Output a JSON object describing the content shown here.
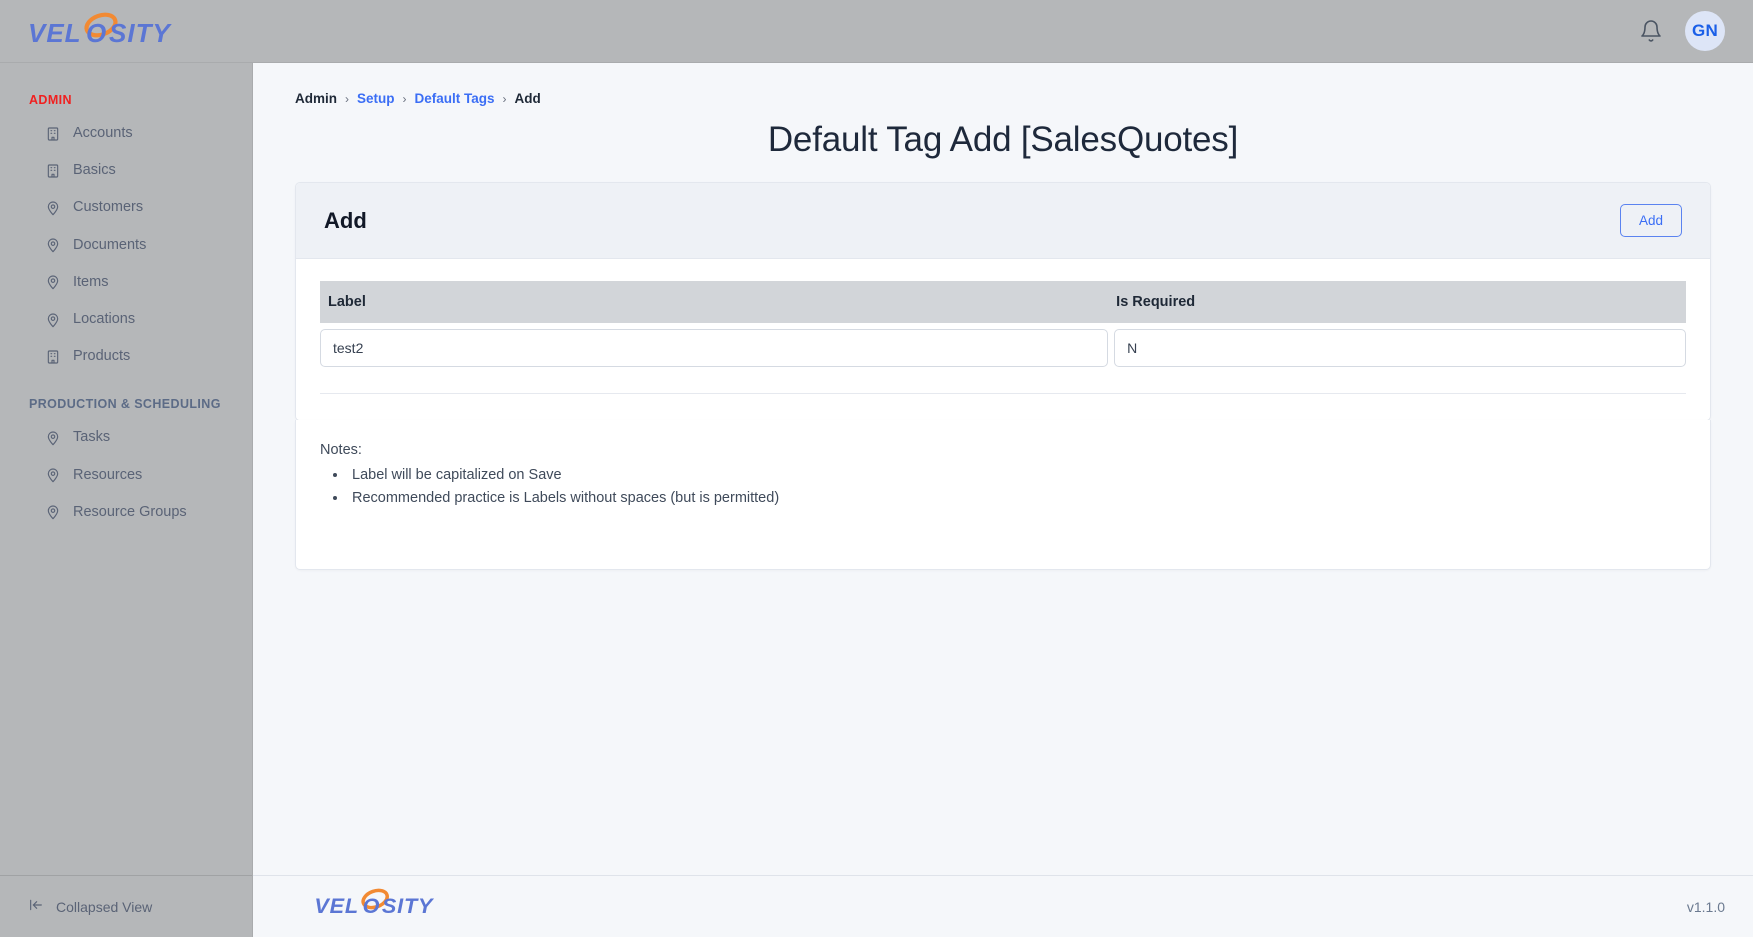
{
  "brand": {
    "name": "VELOSITY",
    "part1": "VEL",
    "part2": "SITY",
    "blue": "#5b76d4",
    "orange": "#f28a33"
  },
  "topbar": {
    "notifications_icon": "bell-icon",
    "avatar_initials": "GN"
  },
  "sidebar": {
    "sections": [
      {
        "title": "ADMIN",
        "color": "#f02020",
        "items": [
          {
            "label": "Accounts",
            "icon": "building-icon"
          },
          {
            "label": "Basics",
            "icon": "building-icon"
          },
          {
            "label": "Customers",
            "icon": "map-pin-icon"
          },
          {
            "label": "Documents",
            "icon": "map-pin-icon"
          },
          {
            "label": "Items",
            "icon": "map-pin-icon"
          },
          {
            "label": "Locations",
            "icon": "map-pin-icon"
          },
          {
            "label": "Products",
            "icon": "building-icon"
          }
        ]
      },
      {
        "title": "PRODUCTION & SCHEDULING",
        "color": "#5c6b86",
        "items": [
          {
            "label": "Tasks",
            "icon": "map-pin-icon"
          },
          {
            "label": "Resources",
            "icon": "map-pin-icon"
          },
          {
            "label": "Resource Groups",
            "icon": "map-pin-icon"
          }
        ]
      }
    ],
    "collapse_label": "Collapsed View",
    "collapse_icon": "collapse-left-icon"
  },
  "breadcrumb": [
    {
      "label": "Admin",
      "link": false
    },
    {
      "label": "Setup",
      "link": true
    },
    {
      "label": "Default Tags",
      "link": true
    },
    {
      "label": "Add",
      "link": false
    }
  ],
  "page": {
    "title": "Default Tag Add [SalesQuotes]"
  },
  "card": {
    "heading": "Add",
    "add_button": "Add",
    "table": {
      "columns": [
        "Label",
        "Is Required"
      ],
      "rows": [
        {
          "label": "test2",
          "is_required": "N"
        }
      ],
      "placeholders": {
        "label": "",
        "is_required": ""
      }
    }
  },
  "notes": {
    "title": "Notes:",
    "items": [
      "Label will be capitalized on Save",
      "Recommended practice is Labels without spaces (but is permitted)"
    ]
  },
  "footer": {
    "version": "v1.1.0"
  }
}
